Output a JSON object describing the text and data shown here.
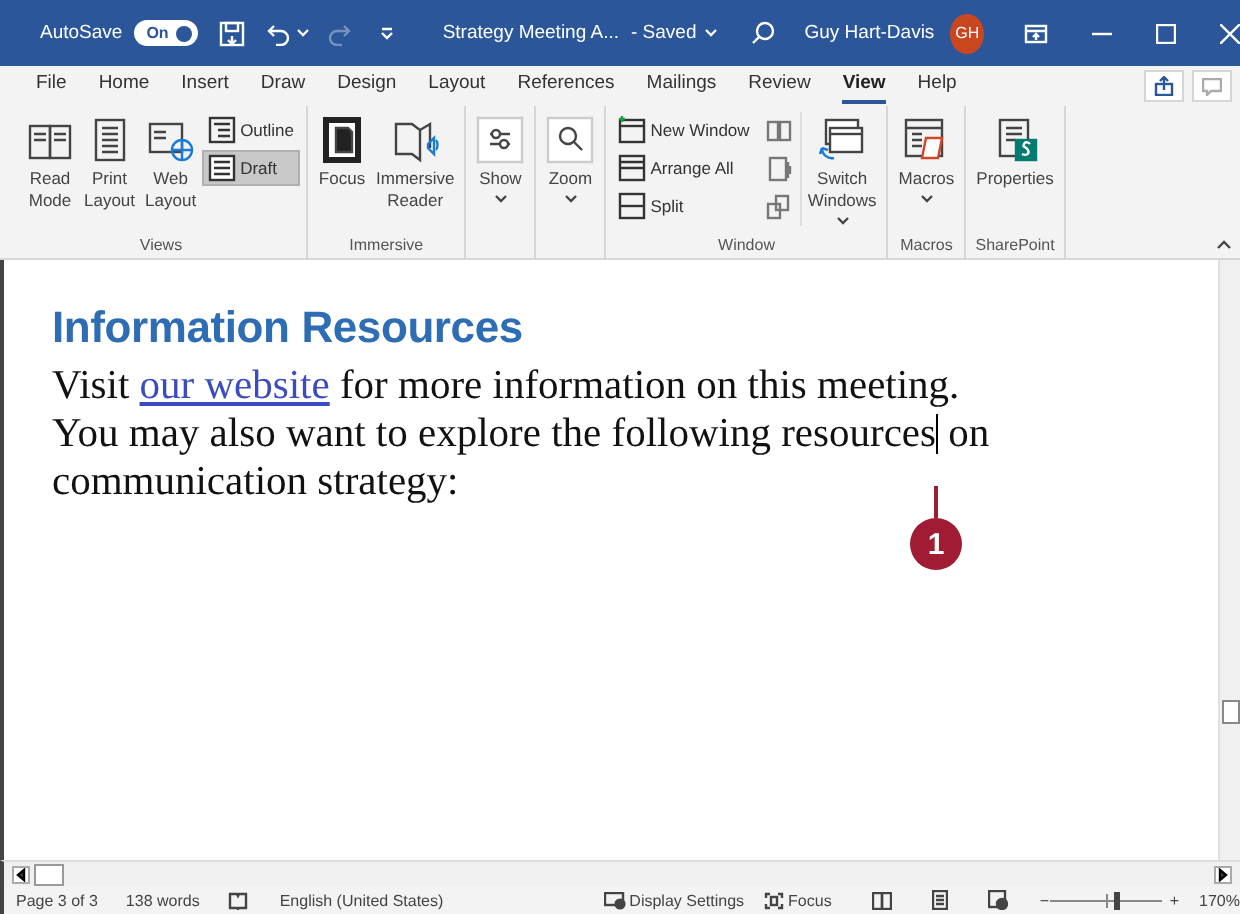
{
  "title_bar": {
    "autosave_label": "AutoSave",
    "autosave": {
      "on": true,
      "label": "On"
    },
    "document_title": "Strategy Meeting A...",
    "save_status": "- Saved",
    "user_name": "Guy Hart-Davis",
    "avatar_initials": "GH"
  },
  "tabs": [
    {
      "label": "File",
      "selected": false
    },
    {
      "label": "Home",
      "selected": false
    },
    {
      "label": "Insert",
      "selected": false
    },
    {
      "label": "Draw",
      "selected": false
    },
    {
      "label": "Design",
      "selected": false
    },
    {
      "label": "Layout",
      "selected": false
    },
    {
      "label": "References",
      "selected": false
    },
    {
      "label": "Mailings",
      "selected": false
    },
    {
      "label": "Review",
      "selected": false
    },
    {
      "label": "View",
      "selected": true
    },
    {
      "label": "Help",
      "selected": false
    }
  ],
  "ribbon": {
    "groups": [
      {
        "name": "Views",
        "items": [
          {
            "kind": "large",
            "label": "Read Mode",
            "selected": false
          },
          {
            "kind": "large",
            "label": "Print Layout",
            "selected": false
          },
          {
            "kind": "large",
            "label": "Web Layout",
            "selected": false
          },
          {
            "kind": "stack",
            "buttons": [
              {
                "label": "Outline",
                "selected": false
              },
              {
                "label": "Draft",
                "selected": true
              }
            ]
          }
        ]
      },
      {
        "name": "Immersive",
        "items": [
          {
            "kind": "large",
            "label": "Focus",
            "selected": false
          },
          {
            "kind": "large",
            "label": "Immersive Reader",
            "selected": false
          }
        ]
      },
      {
        "items": [
          {
            "kind": "large",
            "label": "Show",
            "selected": false,
            "dropdown": true
          }
        ]
      },
      {
        "items": [
          {
            "kind": "large",
            "label": "Zoom",
            "selected": false,
            "dropdown": true
          }
        ]
      },
      {
        "name": "Window",
        "items": [
          {
            "kind": "stack",
            "buttons": [
              {
                "label": "New Window",
                "selected": false
              },
              {
                "label": "Arrange All",
                "selected": false
              },
              {
                "label": "Split",
                "selected": false
              }
            ]
          },
          {
            "kind": "icons"
          },
          {
            "kind": "large",
            "label": "Switch Windows",
            "selected": false,
            "dropdown": true
          }
        ]
      },
      {
        "name": "Macros",
        "items": [
          {
            "kind": "large",
            "label": "Macros",
            "selected": false,
            "dropdown": true
          }
        ]
      },
      {
        "name": "SharePoint",
        "items": [
          {
            "kind": "large",
            "label": "Properties",
            "selected": false
          }
        ]
      }
    ]
  },
  "document": {
    "heading": "Information Resources",
    "paragraph": {
      "before_link": "Visit ",
      "link": "our website",
      "after_link": " for more information on this meeting. You may also want to explore the following resources",
      "after_cursor": " on communication strategy:"
    },
    "callout": "1"
  },
  "status_bar": {
    "page": "Page 3 of 3",
    "words": "138 words",
    "language": "English (United States)",
    "display_settings": "Display Settings",
    "focus": "Focus",
    "zoom_out": "−",
    "zoom_in": "+",
    "zoom": {
      "level": 0.6
    },
    "zoom_percent": "170%"
  }
}
